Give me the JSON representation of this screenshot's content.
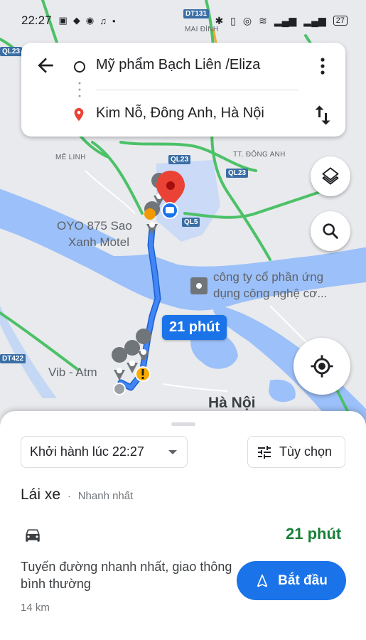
{
  "status_bar": {
    "time": "22:27",
    "battery": "27"
  },
  "search": {
    "origin": "Mỹ phẩm Bạch Liên /Eliza",
    "destination": "Kim Nỗ, Đông Anh, Hà Nội"
  },
  "map": {
    "labels": {
      "me_linh": "MÊ LINH",
      "mai_dinh": "MAI ĐÌNH",
      "tt_dong_anh": "TT. ĐÔNG ANH",
      "motel_line1": "OYO 875 Sao",
      "motel_line2": "Xanh Motel",
      "company_line1": "công ty cổ phần ứng",
      "company_line2": "dụng công nghệ cơ...",
      "atm": "Vib - Atm",
      "city": "Hà Nội"
    },
    "roads": {
      "dt131": "DT131",
      "ql23_left": "QL23",
      "ql23_a": "QL23",
      "ql23_b": "QL23",
      "ql5": "QL5",
      "dt422": "DT422"
    },
    "eta": "21 phút",
    "colors": {
      "route": "#4285f4",
      "route_outline": "#1a5fd0",
      "water": "#9cc0f9",
      "land": "#e8eaed",
      "highway": "#4cc167",
      "pin": "#ea4335"
    }
  },
  "icons": {
    "back": "arrow-left-icon",
    "more": "more-vert-icon",
    "swap": "swap-vert-icon",
    "layers": "layers-icon",
    "search": "search-icon",
    "locate": "my-location-icon",
    "car": "car-icon",
    "navigation": "navigation-icon",
    "tune": "tune-icon"
  },
  "sheet": {
    "depart_label": "Khởi hành lúc 22:27",
    "options_label": "Tùy chọn",
    "mode_title": "Lái xe",
    "mode_sub": "Nhanh nhất",
    "duration": "21 phút",
    "description": "Tuyến đường nhanh nhất, giao thông bình thường",
    "distance": "14 km",
    "start_label": "Bắt đầu"
  }
}
